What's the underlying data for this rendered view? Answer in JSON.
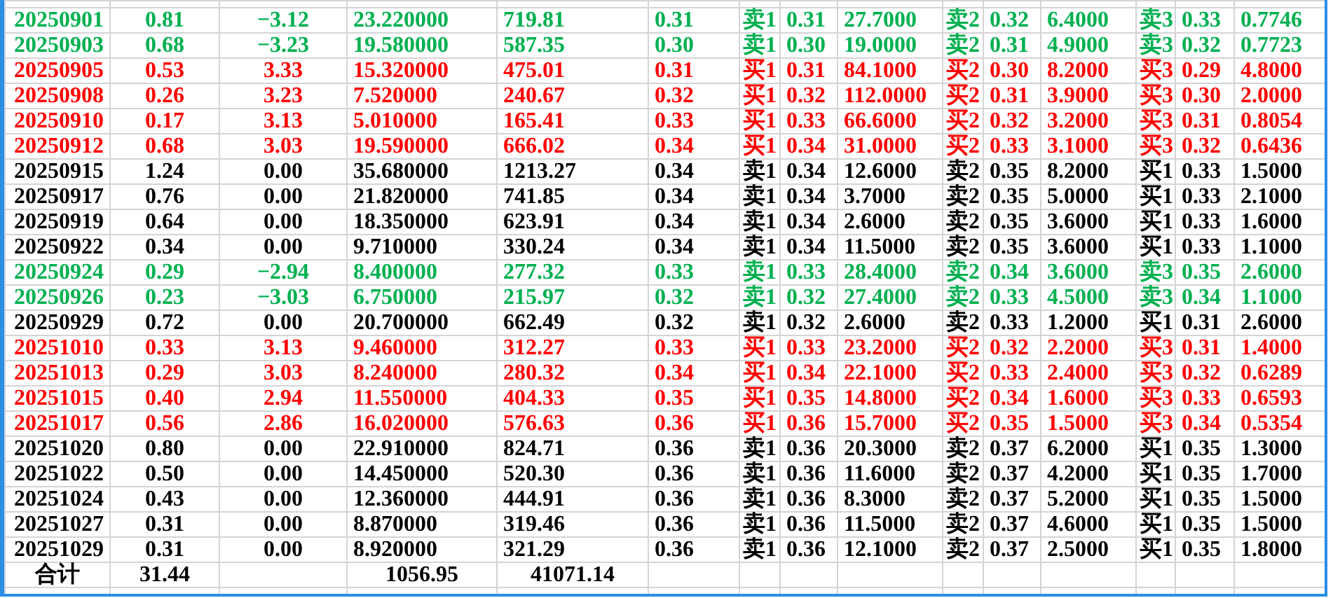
{
  "rows": [
    {
      "color": "#00b050",
      "cells": [
        "20250901",
        "0.81",
        "−3.12",
        "23.220000",
        "719.81",
        "0.31",
        "卖1",
        "0.31",
        "27.7000",
        "卖2",
        "0.32",
        "6.4000",
        "卖3",
        "0.33",
        "0.7746"
      ]
    },
    {
      "color": "#00b050",
      "cells": [
        "20250903",
        "0.68",
        "−3.23",
        "19.580000",
        "587.35",
        "0.30",
        "卖1",
        "0.30",
        "19.0000",
        "卖2",
        "0.31",
        "4.9000",
        "卖3",
        "0.32",
        "0.7723"
      ]
    },
    {
      "color": "#ff0000",
      "cells": [
        "20250905",
        "0.53",
        "3.33",
        "15.320000",
        "475.01",
        "0.31",
        "买1",
        "0.31",
        "84.1000",
        "买2",
        "0.30",
        "8.2000",
        "买3",
        "0.29",
        "4.8000"
      ]
    },
    {
      "color": "#ff0000",
      "cells": [
        "20250908",
        "0.26",
        "3.23",
        "7.520000",
        "240.67",
        "0.32",
        "买1",
        "0.32",
        "112.0000",
        "买2",
        "0.31",
        "3.9000",
        "买3",
        "0.30",
        "2.0000"
      ]
    },
    {
      "color": "#ff0000",
      "cells": [
        "20250910",
        "0.17",
        "3.13",
        "5.010000",
        "165.41",
        "0.33",
        "买1",
        "0.33",
        "66.6000",
        "买2",
        "0.32",
        "3.2000",
        "买3",
        "0.31",
        "0.8054"
      ]
    },
    {
      "color": "#ff0000",
      "cells": [
        "20250912",
        "0.68",
        "3.03",
        "19.590000",
        "666.02",
        "0.34",
        "买1",
        "0.34",
        "31.0000",
        "买2",
        "0.33",
        "3.1000",
        "买3",
        "0.32",
        "0.6436"
      ]
    },
    {
      "color": "#000000",
      "cells": [
        "20250915",
        "1.24",
        "0.00",
        "35.680000",
        "1213.27",
        "0.34",
        "卖1",
        "0.34",
        "12.6000",
        "卖2",
        "0.35",
        "8.2000",
        "买1",
        "0.33",
        "1.5000"
      ]
    },
    {
      "color": "#000000",
      "cells": [
        "20250917",
        "0.76",
        "0.00",
        "21.820000",
        "741.85",
        "0.34",
        "卖1",
        "0.34",
        "3.7000",
        "卖2",
        "0.35",
        "5.0000",
        "买1",
        "0.33",
        "2.1000"
      ]
    },
    {
      "color": "#000000",
      "cells": [
        "20250919",
        "0.64",
        "0.00",
        "18.350000",
        "623.91",
        "0.34",
        "卖1",
        "0.34",
        "2.6000",
        "卖2",
        "0.35",
        "3.6000",
        "买1",
        "0.33",
        "1.6000"
      ]
    },
    {
      "color": "#000000",
      "cells": [
        "20250922",
        "0.34",
        "0.00",
        "9.710000",
        "330.24",
        "0.34",
        "卖1",
        "0.34",
        "11.5000",
        "卖2",
        "0.35",
        "3.6000",
        "买1",
        "0.33",
        "1.1000"
      ]
    },
    {
      "color": "#00b050",
      "cells": [
        "20250924",
        "0.29",
        "−2.94",
        "8.400000",
        "277.32",
        "0.33",
        "卖1",
        "0.33",
        "28.4000",
        "卖2",
        "0.34",
        "3.6000",
        "卖3",
        "0.35",
        "2.6000"
      ]
    },
    {
      "color": "#00b050",
      "cells": [
        "20250926",
        "0.23",
        "−3.03",
        "6.750000",
        "215.97",
        "0.32",
        "卖1",
        "0.32",
        "27.4000",
        "卖2",
        "0.33",
        "4.5000",
        "卖3",
        "0.34",
        "1.1000"
      ]
    },
    {
      "color": "#000000",
      "cells": [
        "20250929",
        "0.72",
        "0.00",
        "20.700000",
        "662.49",
        "0.32",
        "卖1",
        "0.32",
        "2.6000",
        "卖2",
        "0.33",
        "1.2000",
        "买1",
        "0.31",
        "2.6000"
      ]
    },
    {
      "color": "#ff0000",
      "cells": [
        "20251010",
        "0.33",
        "3.13",
        "9.460000",
        "312.27",
        "0.33",
        "买1",
        "0.33",
        "23.2000",
        "买2",
        "0.32",
        "2.2000",
        "买3",
        "0.31",
        "1.4000"
      ]
    },
    {
      "color": "#ff0000",
      "cells": [
        "20251013",
        "0.29",
        "3.03",
        "8.240000",
        "280.32",
        "0.34",
        "买1",
        "0.34",
        "22.1000",
        "买2",
        "0.33",
        "2.4000",
        "买3",
        "0.32",
        "0.6289"
      ]
    },
    {
      "color": "#ff0000",
      "cells": [
        "20251015",
        "0.40",
        "2.94",
        "11.550000",
        "404.33",
        "0.35",
        "买1",
        "0.35",
        "14.8000",
        "买2",
        "0.34",
        "1.6000",
        "买3",
        "0.33",
        "0.6593"
      ]
    },
    {
      "color": "#ff0000",
      "cells": [
        "20251017",
        "0.56",
        "2.86",
        "16.020000",
        "576.63",
        "0.36",
        "买1",
        "0.36",
        "15.7000",
        "买2",
        "0.35",
        "1.5000",
        "买3",
        "0.34",
        "0.5354"
      ]
    },
    {
      "color": "#000000",
      "cells": [
        "20251020",
        "0.80",
        "0.00",
        "22.910000",
        "824.71",
        "0.36",
        "卖1",
        "0.36",
        "20.3000",
        "卖2",
        "0.37",
        "6.2000",
        "买1",
        "0.35",
        "1.3000"
      ]
    },
    {
      "color": "#000000",
      "cells": [
        "20251022",
        "0.50",
        "0.00",
        "14.450000",
        "520.30",
        "0.36",
        "卖1",
        "0.36",
        "11.6000",
        "卖2",
        "0.37",
        "4.2000",
        "买1",
        "0.35",
        "1.7000"
      ]
    },
    {
      "color": "#000000",
      "cells": [
        "20251024",
        "0.43",
        "0.00",
        "12.360000",
        "444.91",
        "0.36",
        "卖1",
        "0.36",
        "8.3000",
        "卖2",
        "0.37",
        "5.2000",
        "买1",
        "0.35",
        "1.5000"
      ]
    },
    {
      "color": "#000000",
      "cells": [
        "20251027",
        "0.31",
        "0.00",
        "8.870000",
        "319.46",
        "0.36",
        "卖1",
        "0.36",
        "11.5000",
        "卖2",
        "0.37",
        "4.6000",
        "买1",
        "0.35",
        "1.5000"
      ]
    },
    {
      "color": "#000000",
      "cells": [
        "20251029",
        "0.31",
        "0.00",
        "8.920000",
        "321.29",
        "0.36",
        "卖1",
        "0.36",
        "12.1000",
        "卖2",
        "0.37",
        "2.5000",
        "买1",
        "0.35",
        "1.8000"
      ]
    }
  ],
  "total": {
    "label": "合计",
    "column_2": "31.44",
    "column_4": "1056.95",
    "column_5": "41071.14"
  }
}
